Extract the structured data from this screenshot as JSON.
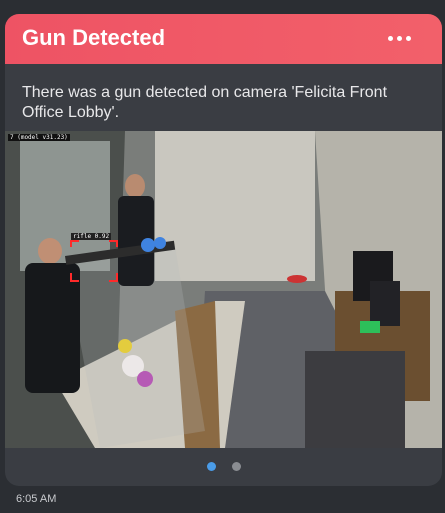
{
  "alert": {
    "title": "Gun Detected",
    "more_icon": "more-dots-icon",
    "message": "There was a gun detected on camera 'Felicita Front Office Lobby'."
  },
  "camera": {
    "overlay_model": "7 (model v31.23)",
    "detection_label": "rifle 0.92"
  },
  "carousel": {
    "pages": 2,
    "active_index": 0,
    "active_color": "#4a9ce8",
    "inactive_color": "#8a8d92"
  },
  "footer": {
    "time": "6:05 AM"
  },
  "colors": {
    "header": "#ee5364",
    "card": "#3a3d43",
    "background": "#2b2e33",
    "detection_box": "#ff2a2a"
  }
}
